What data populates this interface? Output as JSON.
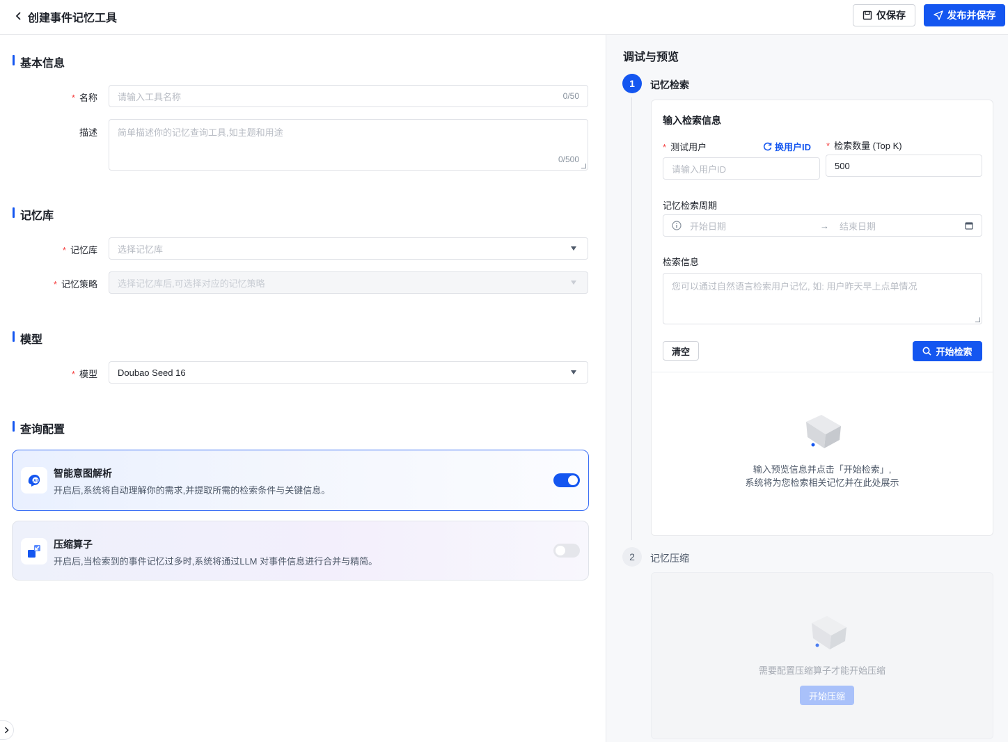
{
  "header": {
    "title": "创建事件记忆工具",
    "save_only_label": "仅保存",
    "publish_label": "发布并保存"
  },
  "basic": {
    "section_title": "基本信息",
    "name_label": "名称",
    "name_placeholder": "请输入工具名称",
    "name_count": "0/50",
    "desc_label": "描述",
    "desc_placeholder": "简单描述你的记忆查询工具,如主题和用途",
    "desc_count": "0/500"
  },
  "memory": {
    "section_title": "记忆库",
    "library_label": "记忆库",
    "library_placeholder": "选择记忆库",
    "strategy_label": "记忆策略",
    "strategy_placeholder": "选择记忆库后,可选择对应的记忆策略"
  },
  "model": {
    "section_title": "模型",
    "label": "模型",
    "value": "Doubao Seed 16"
  },
  "query": {
    "section_title": "查询配置",
    "cards": [
      {
        "title": "智能意图解析",
        "desc": "开启后,系统将自动理解你的需求,并提取所需的检索条件与关键信息。",
        "enabled": true
      },
      {
        "title": "压缩算子",
        "desc": "开启后,当检索到的事件记忆过多时,系统将通过LLM 对事件信息进行合并与精简。",
        "enabled": false
      }
    ]
  },
  "preview": {
    "title": "调试与预览",
    "step1": {
      "number": "1",
      "label": "记忆检索",
      "panel_title": "输入检索信息",
      "user_label": "测试用户",
      "switch_user_label": "换用户ID",
      "user_placeholder": "请输入用户ID",
      "topk_label": "检索数量 (Top K)",
      "topk_value": "500",
      "period_label": "记忆检索周期",
      "start_placeholder": "开始日期",
      "arrow": "→",
      "end_placeholder": "结束日期",
      "query_label": "检索信息",
      "query_placeholder": "您可以通过自然语言检索用户记忆, 如: 用户昨天早上点单情况",
      "clear_label": "清空",
      "search_label": "开始检索",
      "empty_line1": "输入预览信息并点击「开始检索」,",
      "empty_line2": "系统将为您检索相关记忆并在此处展示"
    },
    "step2": {
      "number": "2",
      "label": "记忆压缩",
      "empty_text": "需要配置压缩算子才能开始压缩",
      "button_label": "开始压缩"
    }
  },
  "colors": {
    "primary": "#1456f0",
    "required": "#f53f3f"
  }
}
